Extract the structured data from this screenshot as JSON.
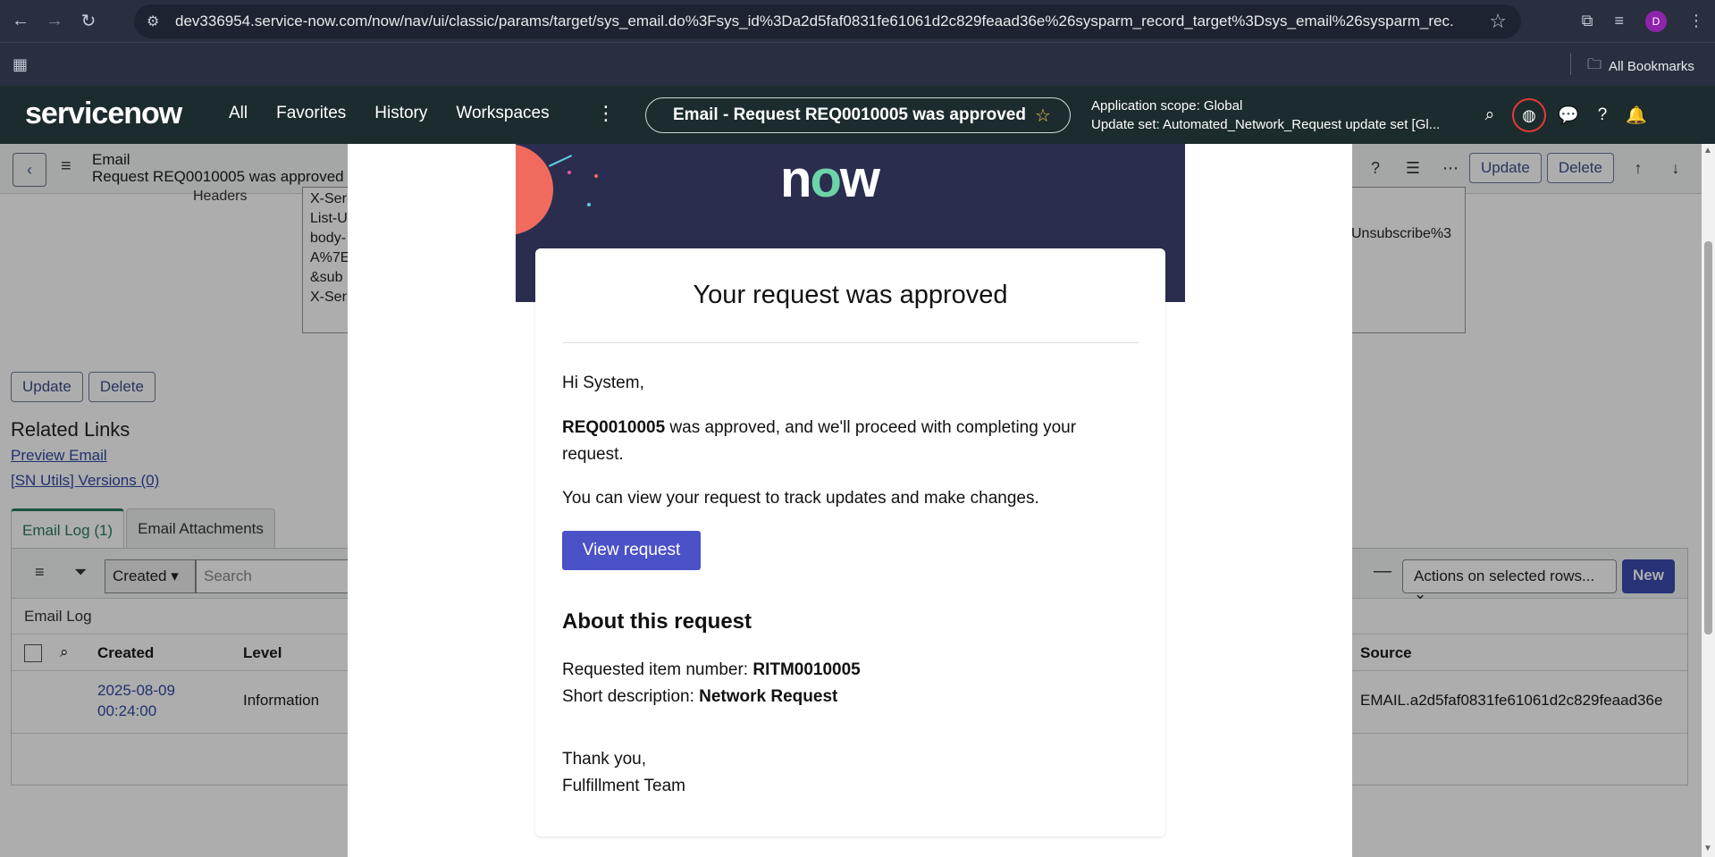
{
  "browser": {
    "url": "dev336954.service-now.com/now/nav/ui/classic/params/target/sys_email.do%3Fsys_id%3Da2d5faf0831fe61061d2c829feaad36e%26sysparm_record_target%3Dsys_email%26sysparm_rec...",
    "avatar_letter": "D",
    "bookmarks_label": "All Bookmarks"
  },
  "sn_header": {
    "logo": "servicenow",
    "nav": [
      "All",
      "Favorites",
      "History",
      "Workspaces"
    ],
    "record_pill": "Email - Request REQ0010005 was approved",
    "scope_line1": "Application scope: Global",
    "scope_line2": "Update set: Automated_Network_Request update set [Gl..."
  },
  "record": {
    "table_label": "Email",
    "record_name": "Request REQ0010005 was approved",
    "update_label": "Update",
    "delete_label": "Delete",
    "headers_label": "Headers",
    "headers_lines": [
      "X-Ser",
      "List-U",
      "body-",
      "A%7E",
      " &sub",
      "X-Ser"
    ],
    "headers_tail": "Unsubscribe%3"
  },
  "related": {
    "title": "Related Links",
    "links": [
      "Preview Email",
      "[SN Utils] Versions (0)"
    ]
  },
  "tabs": [
    "Email Log (1)",
    "Email Attachments"
  ],
  "list": {
    "created_select": "Created",
    "search_placeholder": "Search",
    "actions_select": "Actions on selected rows...",
    "new_label": "New",
    "section_label": "Email Log",
    "columns": [
      "Created",
      "Level",
      "Source"
    ],
    "row": {
      "created_line1": "2025-08-09",
      "created_line2": "00:24:00",
      "level": "Information",
      "source": "EMAIL.a2d5faf0831fe61061d2c829feaad36e"
    }
  },
  "email": {
    "logo": "now",
    "heading": "Your request was approved",
    "greeting": "Hi System,",
    "req_number": "REQ0010005",
    "approved_text": " was approved, and we'll proceed with completing your request.",
    "view_text": "You can view your request to track updates and make changes.",
    "button_label": "View request",
    "about_heading": "About this request",
    "item_label": "Requested item number: ",
    "item_value": "RITM0010005",
    "desc_label": "Short description: ",
    "desc_value": "Network Request",
    "closing1": "Thank you,",
    "closing2": "Fulfillment Team"
  }
}
